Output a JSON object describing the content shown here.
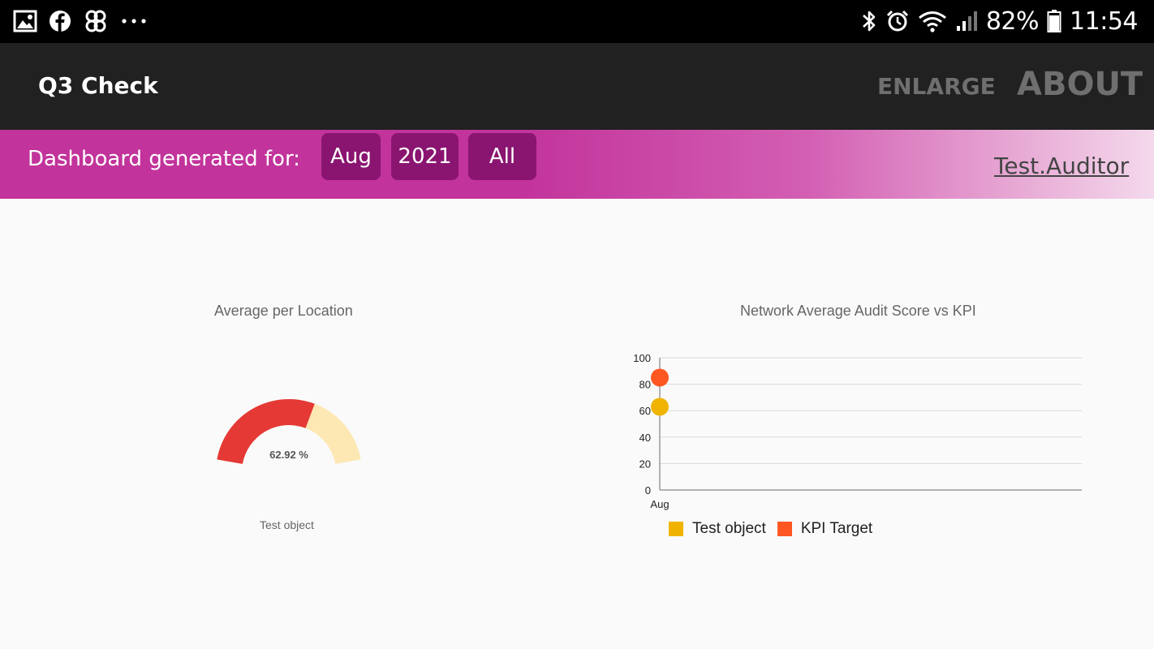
{
  "status_bar": {
    "battery": "82%",
    "time": "11:54",
    "left_icons": [
      "gallery-icon",
      "facebook-icon",
      "pinwheel-icon",
      "more-dots-icon"
    ],
    "right_icons": [
      "bluetooth-icon",
      "alarm-icon",
      "wifi-icon",
      "signal-icon",
      "battery-icon"
    ]
  },
  "app_bar": {
    "title": "Q3 Check",
    "actions": [
      "ENLARGE",
      "ABOUT"
    ]
  },
  "filter": {
    "label": "Dashboard generated for:",
    "month": "Aug",
    "year": "2021",
    "scope": "All",
    "user": "Test.Auditor"
  },
  "colors": {
    "accent": "#c2339b",
    "chip": "#8a1570",
    "gauge_fill": "#e53935",
    "gauge_track": "#fde8b3",
    "series_test_object": "#f0b400",
    "series_kpi_target": "#ff5722"
  },
  "chart_data": [
    {
      "type": "gauge",
      "title": "Average per Location",
      "value": 62.92,
      "max": 100,
      "value_label": "62.92 %",
      "category": "Test object"
    },
    {
      "type": "line",
      "title": "Network Average Audit Score vs KPI",
      "x": [
        "Aug"
      ],
      "ylim": [
        0,
        100
      ],
      "yticks": [
        0,
        20,
        40,
        60,
        80,
        100
      ],
      "grid": true,
      "legend_position": "bottom",
      "series": [
        {
          "name": "Test object",
          "values": [
            62.92
          ],
          "color": "#f0b400"
        },
        {
          "name": "KPI Target",
          "values": [
            85
          ],
          "color": "#ff5722"
        }
      ]
    }
  ]
}
